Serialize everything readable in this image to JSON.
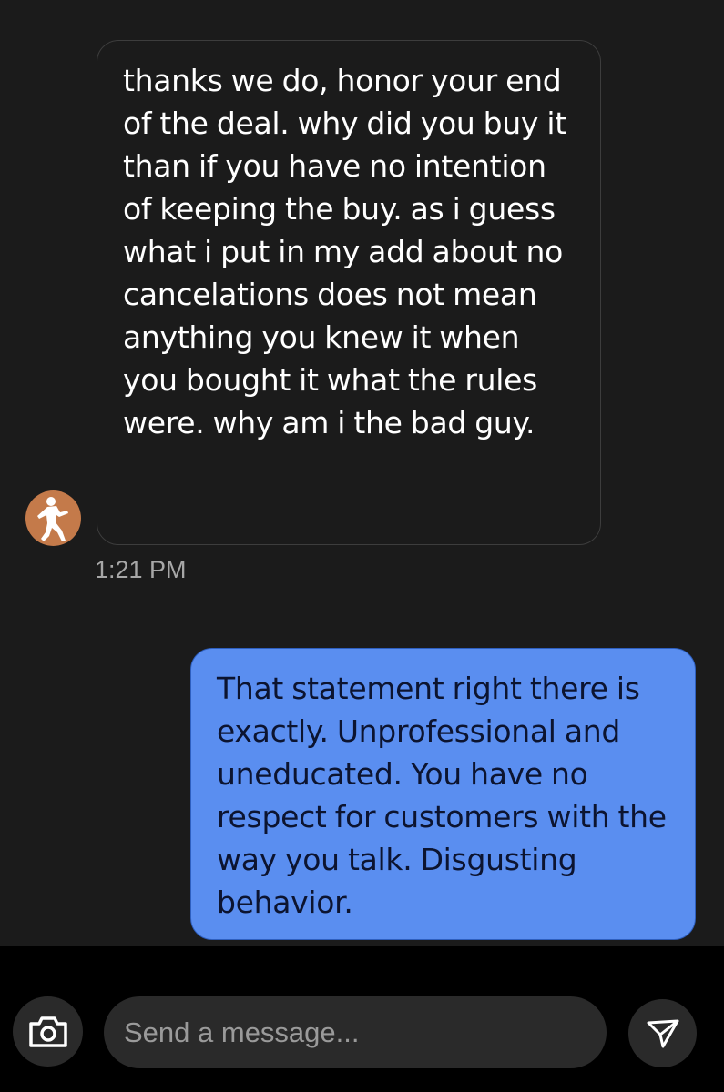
{
  "conversation": {
    "incoming": {
      "text": "thanks we do, honor your end of the deal. why did you buy it than if you have no intention of keeping the buy. as i guess what i put in my add about no cancelations does not mean anything you knew it when you bought it what the rules were. why am i the bad guy.",
      "timestamp": "1:21 PM",
      "avatar_icon": "player-silhouette-icon",
      "avatar_color": "#c47a4a"
    },
    "outgoing": {
      "text": "That statement right there is exactly. Unprofessional and uneducated. You have no respect for customers with the way you talk. Disgusting behavior.",
      "bubble_color": "#5a8ef0"
    }
  },
  "composer": {
    "camera_icon": "camera-icon",
    "placeholder": "Send a message...",
    "value": "",
    "send_icon": "send-icon"
  }
}
